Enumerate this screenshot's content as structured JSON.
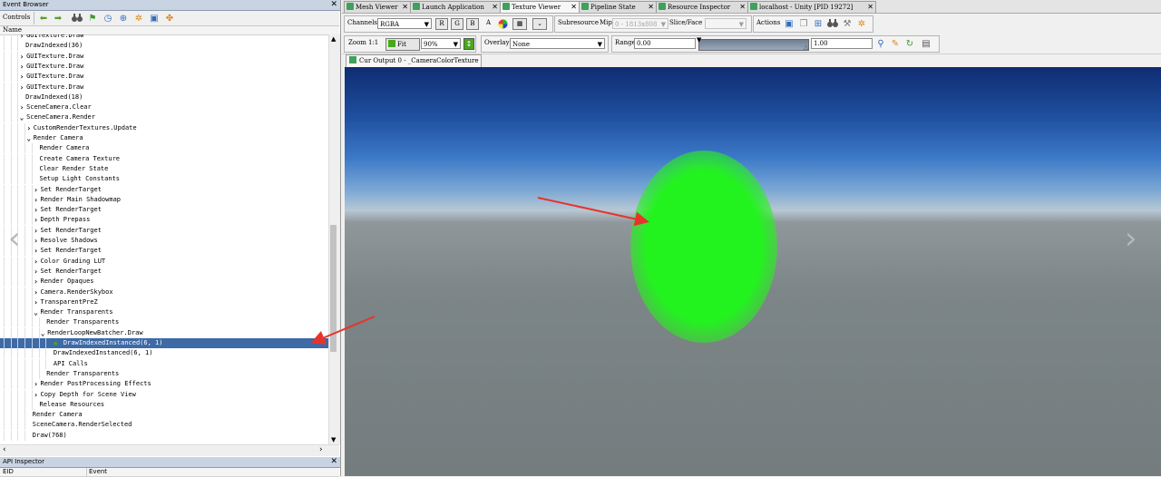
{
  "event_browser": {
    "title": "Event Browser",
    "controls_label": "Controls",
    "column_name": "Name",
    "rows": [
      {
        "text": "GUITexture.Draw",
        "exp": ">"
      },
      {
        "text": "DrawIndexed(36)",
        "exp": ""
      },
      {
        "text": "GUITexture.Draw",
        "exp": ">"
      },
      {
        "text": "GUITexture.Draw",
        "exp": ">"
      },
      {
        "text": "GUITexture.Draw",
        "exp": ">"
      },
      {
        "text": "GUITexture.Draw",
        "exp": ">"
      },
      {
        "text": "DrawIndexed(18)",
        "exp": ""
      },
      {
        "text": "SceneCamera.Clear",
        "exp": ">"
      },
      {
        "text": "SceneCamera.Render",
        "exp": "v"
      },
      {
        "text": "CustomRenderTextures.Update",
        "exp": ">"
      },
      {
        "text": "Render Camera",
        "exp": "v"
      },
      {
        "text": "Render Camera",
        "exp": ""
      },
      {
        "text": "Create Camera Texture",
        "exp": ""
      },
      {
        "text": "Clear Render State",
        "exp": ""
      },
      {
        "text": "Setup Light Constants",
        "exp": ""
      },
      {
        "text": "Set RenderTarget",
        "exp": ">"
      },
      {
        "text": "Render Main Shadowmap",
        "exp": ">"
      },
      {
        "text": "Set RenderTarget",
        "exp": ">"
      },
      {
        "text": "Depth Prepass",
        "exp": ">"
      },
      {
        "text": "Set RenderTarget",
        "exp": ">"
      },
      {
        "text": "Resolve Shadows",
        "exp": ">"
      },
      {
        "text": "Set RenderTarget",
        "exp": ">"
      },
      {
        "text": "Color Grading LUT",
        "exp": ">"
      },
      {
        "text": "Set RenderTarget",
        "exp": ">"
      },
      {
        "text": "Render Opaques",
        "exp": ">"
      },
      {
        "text": "Camera.RenderSkybox",
        "exp": ">"
      },
      {
        "text": "TransparentPreZ",
        "exp": ">"
      },
      {
        "text": "Render Transparents",
        "exp": "v"
      },
      {
        "text": "Render Transparents",
        "exp": ""
      },
      {
        "text": "RenderLoopNewBatcher.Draw",
        "exp": "v"
      },
      {
        "text": "DrawIndexedInstanced(6, 1)",
        "exp": "",
        "selected": true
      },
      {
        "text": "DrawIndexedInstanced(6, 1)",
        "exp": ""
      },
      {
        "text": "API Calls",
        "exp": ""
      },
      {
        "text": "Render Transparents",
        "exp": ""
      },
      {
        "text": "Render PostProcessing Effects",
        "exp": ">"
      },
      {
        "text": "Copy Depth for Scene View",
        "exp": ">"
      },
      {
        "text": "Release Resources",
        "exp": ""
      },
      {
        "text": "Render Camera",
        "exp": ""
      },
      {
        "text": "SceneCamera.RenderSelected",
        "exp": ""
      },
      {
        "text": "Draw(768)",
        "exp": ""
      }
    ]
  },
  "api_inspector": {
    "title": "API Inspector",
    "col_eid": "EID",
    "col_event": "Event"
  },
  "tabs": [
    {
      "label": "Mesh Viewer"
    },
    {
      "label": "Launch Application"
    },
    {
      "label": "Texture Viewer",
      "active": true
    },
    {
      "label": "Pipeline State"
    },
    {
      "label": "Resource Inspector"
    },
    {
      "label": "localhost - Unity [PID 19272]"
    }
  ],
  "toolbar": {
    "channels_label": "Channels",
    "channels_value": "RGBA",
    "r": "R",
    "g": "G",
    "b": "B",
    "a": "A",
    "subresource_label": "Subresource",
    "mip_label": "Mip",
    "mip_value": "0 - 1813x808",
    "slice_label": "Slice/Face",
    "slice_value": "",
    "actions_label": "Actions",
    "zoom_label": "Zoom",
    "zoom_11": "1:1",
    "fit_label": "Fit",
    "zoom_value": "90%",
    "overlay_label": "Overlay",
    "overlay_value": "None",
    "range_label": "Range",
    "range_min": "0.00",
    "range_max": "1.00"
  },
  "texture_tab": {
    "label": "Cur Output 0 - _CameraColorTexture"
  },
  "colors": {
    "selection": "#3e6aa6",
    "ball": "#22f31e",
    "annotation_arrow": "#e8332d",
    "tab_icon": "#3fa15b"
  }
}
